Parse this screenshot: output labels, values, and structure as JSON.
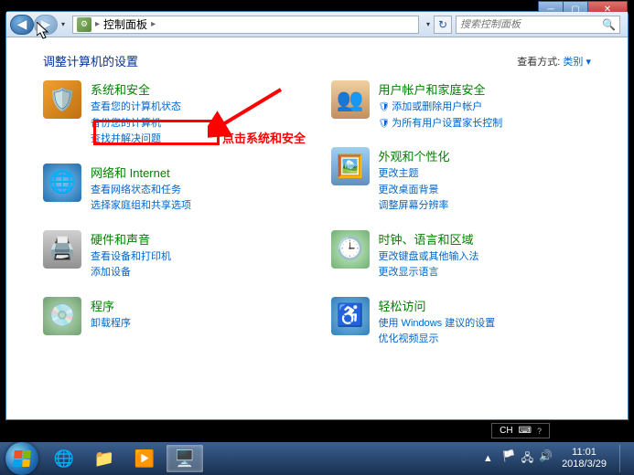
{
  "window": {
    "breadcrumb": "控制面板",
    "search_placeholder": "搜索控制面板"
  },
  "header": {
    "title": "调整计算机的设置",
    "view_label": "查看方式:",
    "view_value": "类别 ▾"
  },
  "annotation": {
    "text": "点击系统和安全"
  },
  "left": [
    {
      "title": "系统和安全",
      "icon": "shield",
      "links": [
        {
          "text": "查看您的计算机状态"
        },
        {
          "text": "备份您的计算机"
        },
        {
          "text": "查找并解决问题"
        }
      ]
    },
    {
      "title": "网络和 Internet",
      "icon": "net",
      "links": [
        {
          "text": "查看网络状态和任务"
        },
        {
          "text": "选择家庭组和共享选项"
        }
      ]
    },
    {
      "title": "硬件和声音",
      "icon": "hw",
      "links": [
        {
          "text": "查看设备和打印机"
        },
        {
          "text": "添加设备"
        }
      ]
    },
    {
      "title": "程序",
      "icon": "prog",
      "links": [
        {
          "text": "卸载程序"
        }
      ]
    }
  ],
  "right": [
    {
      "title": "用户帐户和家庭安全",
      "icon": "user",
      "links": [
        {
          "text": "添加或删除用户帐户",
          "shield": true
        },
        {
          "text": "为所有用户设置家长控制",
          "shield": true
        }
      ]
    },
    {
      "title": "外观和个性化",
      "icon": "appear",
      "links": [
        {
          "text": "更改主题"
        },
        {
          "text": "更改桌面背景"
        },
        {
          "text": "调整屏幕分辨率"
        }
      ]
    },
    {
      "title": "时钟、语言和区域",
      "icon": "clock",
      "links": [
        {
          "text": "更改键盘或其他输入法"
        },
        {
          "text": "更改显示语言"
        }
      ]
    },
    {
      "title": "轻松访问",
      "icon": "ease",
      "links": [
        {
          "text": "使用 Windows 建议的设置"
        },
        {
          "text": "优化视频显示"
        }
      ]
    }
  ],
  "lang": {
    "code": "CH",
    "icon": "⌨"
  },
  "clock": {
    "time": "11:01",
    "date": "2018/3/29"
  },
  "tray_arrow": "▲"
}
